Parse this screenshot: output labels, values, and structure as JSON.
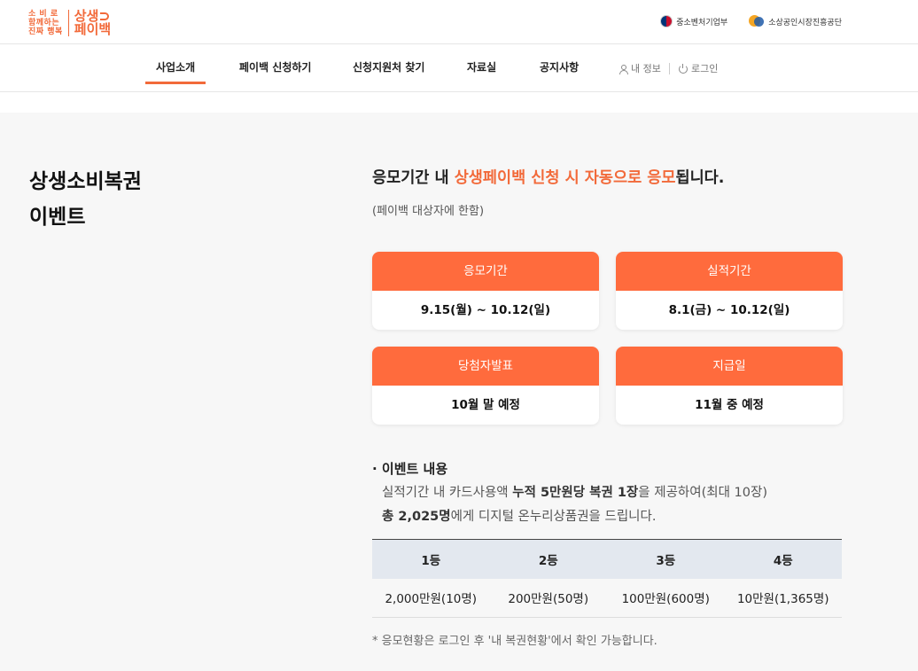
{
  "header": {
    "logo_small": [
      "소 비 로",
      "함께하는",
      "진짜 행복"
    ],
    "logo_big": [
      "상생",
      "페이백"
    ],
    "org1": "중소벤처기업부",
    "org2": "소상공인시장진흥공단"
  },
  "nav": {
    "items": [
      "사업소개",
      "페이백 신청하기",
      "신청지원처 찾기",
      "자료실",
      "공지사항"
    ],
    "active": "사업소개",
    "my_info": "내 정보",
    "login": "로그인"
  },
  "section": {
    "title_line1": "상생소비복권",
    "title_line2": "이벤트"
  },
  "headline": {
    "prefix": "응모기간 내 ",
    "highlight": "상생페이백 신청 시 자동으로 응모",
    "suffix": "됩니다.",
    "note": "(페이백 대상자에 한함)"
  },
  "cards": [
    {
      "label": "응모기간",
      "value": "9.15(월) ~ 10.12(일)"
    },
    {
      "label": "실적기간",
      "value": "8.1(금) ~ 10.12(일)"
    },
    {
      "label": "당첨자발표",
      "value": "10월 말 예정"
    },
    {
      "label": "지급일",
      "value": "11월 중 예정"
    }
  ],
  "event": {
    "title": "· 이벤트 내용",
    "line1_a": "실적기간 내 카드사용액 ",
    "line1_b": "누적 5만원당 복권 1장",
    "line1_c": "을 제공하여(최대 10장)",
    "line2_a": "총 2,025명",
    "line2_b": "에게 디지털 온누리상품권을 드립니다."
  },
  "prizes": {
    "headers": [
      "1등",
      "2등",
      "3등",
      "4등"
    ],
    "values": [
      "2,000만원(10명)",
      "200만원(50명)",
      "100만원(600명)",
      "10만원(1,365명)"
    ]
  },
  "footnote": "* 응모현황은 로그인 후 '내 복권현황'에서 확인 가능합니다.",
  "colors": {
    "accent": "#f26a3a",
    "card_head": "#ff6b3d",
    "table_head": "#e3e8ef"
  }
}
